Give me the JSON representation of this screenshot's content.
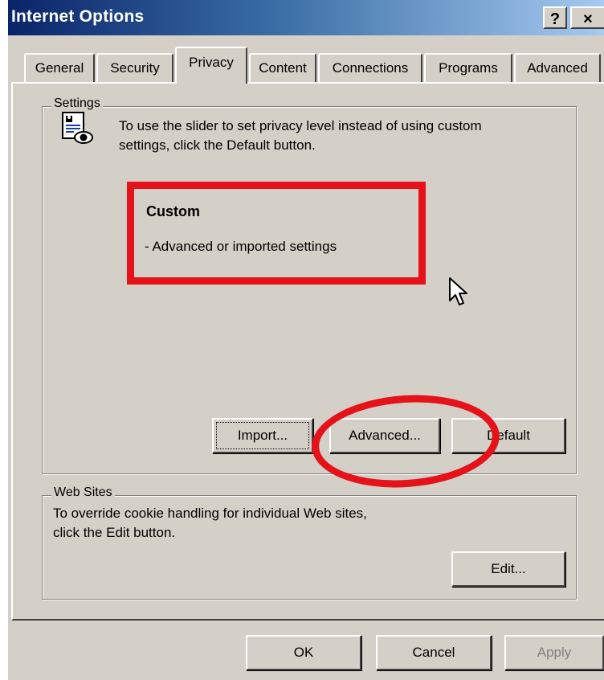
{
  "window": {
    "title": "Internet Options",
    "help_label": "?",
    "close_label": "×"
  },
  "tabs": [
    {
      "label": "General",
      "active": false
    },
    {
      "label": "Security",
      "active": false
    },
    {
      "label": "Privacy",
      "active": true
    },
    {
      "label": "Content",
      "active": false
    },
    {
      "label": "Connections",
      "active": false
    },
    {
      "label": "Programs",
      "active": false
    },
    {
      "label": "Advanced",
      "active": false
    }
  ],
  "settings": {
    "group_label": "Settings",
    "description_line1": "To use the slider to set privacy level instead of using custom",
    "description_line2": "settings, click the Default button.",
    "level_title": "Custom",
    "level_description": "- Advanced or imported settings",
    "buttons": {
      "import": "Import...",
      "advanced": "Advanced...",
      "default": "Default"
    }
  },
  "web_sites": {
    "group_label": "Web Sites",
    "description_line1": "To override cookie handling for individual Web sites,",
    "description_line2": "click the Edit button.",
    "edit_button": "Edit..."
  },
  "footer": {
    "ok": "OK",
    "cancel": "Cancel",
    "apply": "Apply"
  },
  "colors": {
    "annotation": "#e6121a",
    "titlebar_start": "#0a246a",
    "dialog_face": "#d4d0c8"
  },
  "icons": {
    "privacy": "privacy-eye-document-icon",
    "cursor": "mouse-pointer-icon"
  }
}
